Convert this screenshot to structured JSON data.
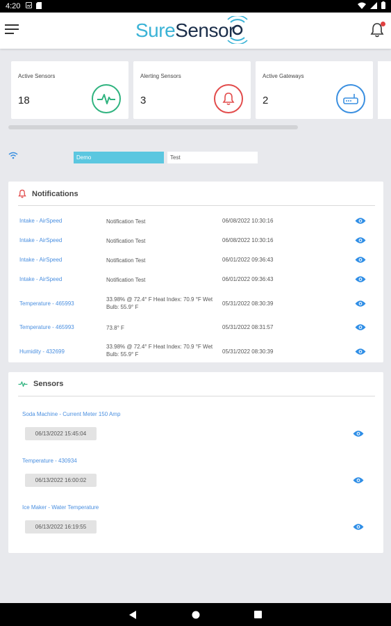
{
  "status_bar": {
    "time": "4:20"
  },
  "header": {
    "logo_part1": "Sure",
    "logo_part2": "Sensor"
  },
  "stats": [
    {
      "label": "Active Sensors",
      "value": "18",
      "icon": "pulse-icon",
      "color": "#2fb37f"
    },
    {
      "label": "Alerting Sensors",
      "value": "3",
      "icon": "bell-icon",
      "color": "#e24b4b"
    },
    {
      "label": "Active Gateways",
      "value": "2",
      "icon": "router-icon",
      "color": "#3a8fe0"
    }
  ],
  "tabs": {
    "active": "Demo",
    "inactive": "Test"
  },
  "notifications": {
    "title": "Notifications",
    "rows": [
      {
        "source": "Intake - AirSpeed",
        "message": "Notification Test",
        "datetime": "06/08/2022 10:30:16"
      },
      {
        "source": "Intake - AirSpeed",
        "message": "Notification Test",
        "datetime": "06/08/2022 10:30:16"
      },
      {
        "source": "Intake - AirSpeed",
        "message": "Notification Test",
        "datetime": "06/01/2022 09:36:43"
      },
      {
        "source": "Intake - AirSpeed",
        "message": "Notification Test",
        "datetime": "06/01/2022 09:36:43"
      },
      {
        "source": "Temperature - 465993",
        "message": "33.98% @ 72.4° F Heat Index: 70.9 °F Wet Bulb: 55.9° F",
        "datetime": "05/31/2022 08:30:39"
      },
      {
        "source": "Temperature - 465993",
        "message": "73.8° F",
        "datetime": "05/31/2022 08:31:57"
      },
      {
        "source": "Humidity - 432699",
        "message": "33.98% @ 72.4° F Heat Index: 70.9 °F Wet Bulb: 55.9° F",
        "datetime": "05/31/2022 08:30:39"
      }
    ]
  },
  "sensors": {
    "title": "Sensors",
    "items": [
      {
        "name": "Soda Machine - Current Meter 150 Amp",
        "time": "06/13/2022 15:45:04"
      },
      {
        "name": "Temperature - 430934",
        "time": "06/13/2022 16:00:02"
      },
      {
        "name": "Ice Maker - Water Temperature",
        "time": "06/13/2022 16:19:55"
      }
    ]
  }
}
